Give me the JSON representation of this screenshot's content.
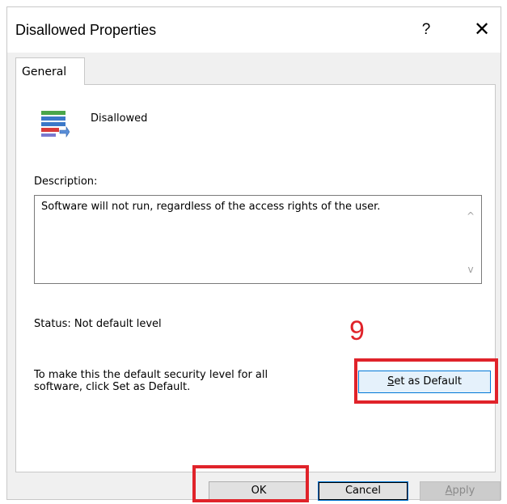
{
  "window": {
    "title": "Disallowed Properties",
    "help_label": "?",
    "close_label": "✕"
  },
  "tabs": [
    {
      "label": "General"
    }
  ],
  "level": {
    "name": "Disallowed",
    "icon": "security-level-icon"
  },
  "description": {
    "label": "Description:",
    "text": "Software will not run, regardless of the access rights of the user.",
    "scroll_up_label": "^",
    "scroll_down_label": "v"
  },
  "status": {
    "text": "Status: Not default level"
  },
  "callout": {
    "number": "9"
  },
  "instructions": {
    "text": "To make this the default security level for all software, click Set as Default."
  },
  "buttons": {
    "set_default_first": "S",
    "set_default_rest": "et as Default",
    "ok": "OK",
    "cancel": "Cancel",
    "apply_first": "A",
    "apply_rest": "pply"
  },
  "colors": {
    "highlight": "#e0232a",
    "focus_blue": "#0078d7"
  }
}
